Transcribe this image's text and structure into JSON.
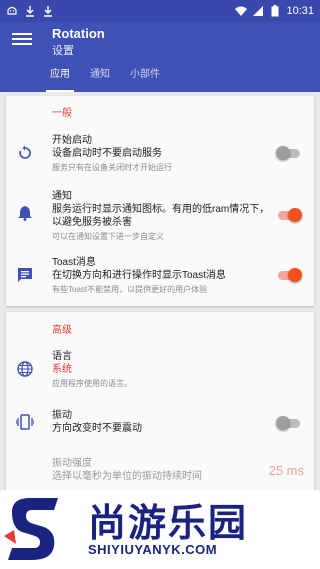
{
  "statusbar": {
    "time": "10:31",
    "icons": [
      "android-debug-icon",
      "download-icon",
      "download-icon",
      "wifi-icon",
      "signal-icon",
      "battery-icon"
    ]
  },
  "appbar": {
    "title": "Rotation",
    "subtitle": "设置",
    "tabs": [
      {
        "label": "应用",
        "active": true
      },
      {
        "label": "通知",
        "active": false
      },
      {
        "label": "小部件",
        "active": false
      }
    ]
  },
  "general": {
    "header": "一般",
    "items": [
      {
        "title": "开始启动",
        "summary": "设备启动时不要启动服务",
        "hint": "服务只有在设备关闭时才开始运行",
        "switch_on": false,
        "icon": "restart-icon"
      },
      {
        "title": "通知",
        "summary": "服务运行时显示通知图标。有用的低ram情况下，以避免服务被杀害",
        "hint": "可以在通知设置下进一步自定义",
        "switch_on": true,
        "icon": "bell-icon"
      },
      {
        "title": "Toast消息",
        "summary": "在切换方向和进行操作时显示Toast消息",
        "hint": "有些Toast不能禁用，以提供更好的用户体验",
        "switch_on": true,
        "icon": "message-icon"
      }
    ]
  },
  "advanced": {
    "header": "高级",
    "language": {
      "title": "语言",
      "value": "系统",
      "hint": "应用程序使用的语言。",
      "icon": "globe-icon"
    },
    "vibration": {
      "title": "振动",
      "summary": "方向改变时不要震动",
      "switch_on": false,
      "icon": "vibration-icon"
    },
    "vibration_strength": {
      "title": "振动强度",
      "summary": "选择以毫秒为单位的振动持续时间",
      "value": "25 ms"
    }
  },
  "banner": {
    "title": "尚游乐园",
    "url": "SHIYIUYANYK.COM"
  },
  "colors": {
    "primary": "#3f51b5",
    "primary_dark": "#3949ab",
    "accent": "#f4511e",
    "section_header": "#e53935"
  }
}
